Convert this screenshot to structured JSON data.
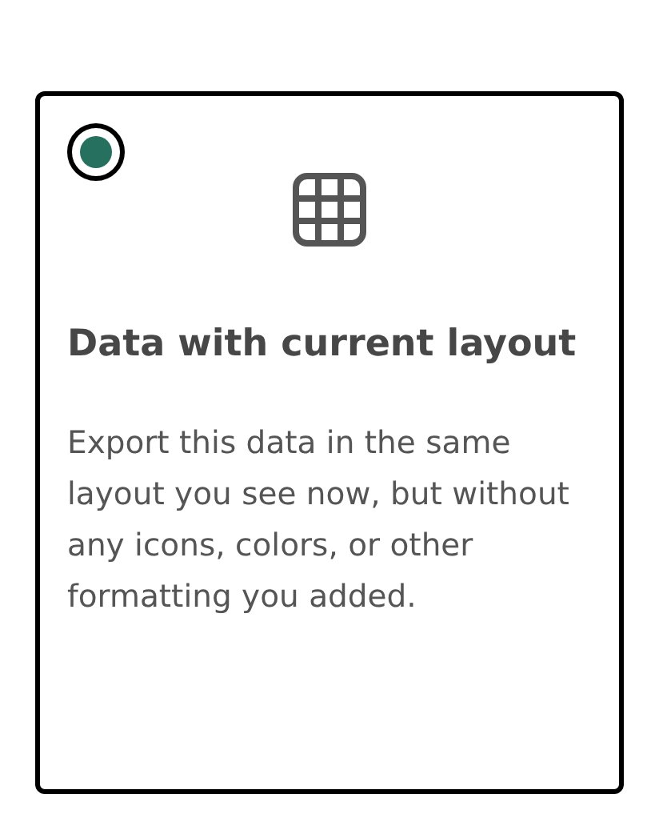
{
  "option": {
    "selected": true,
    "title": "Data with current layout",
    "description": "Export this data in the same layout you see now, but without any icons, colors, or other formatting you added."
  }
}
